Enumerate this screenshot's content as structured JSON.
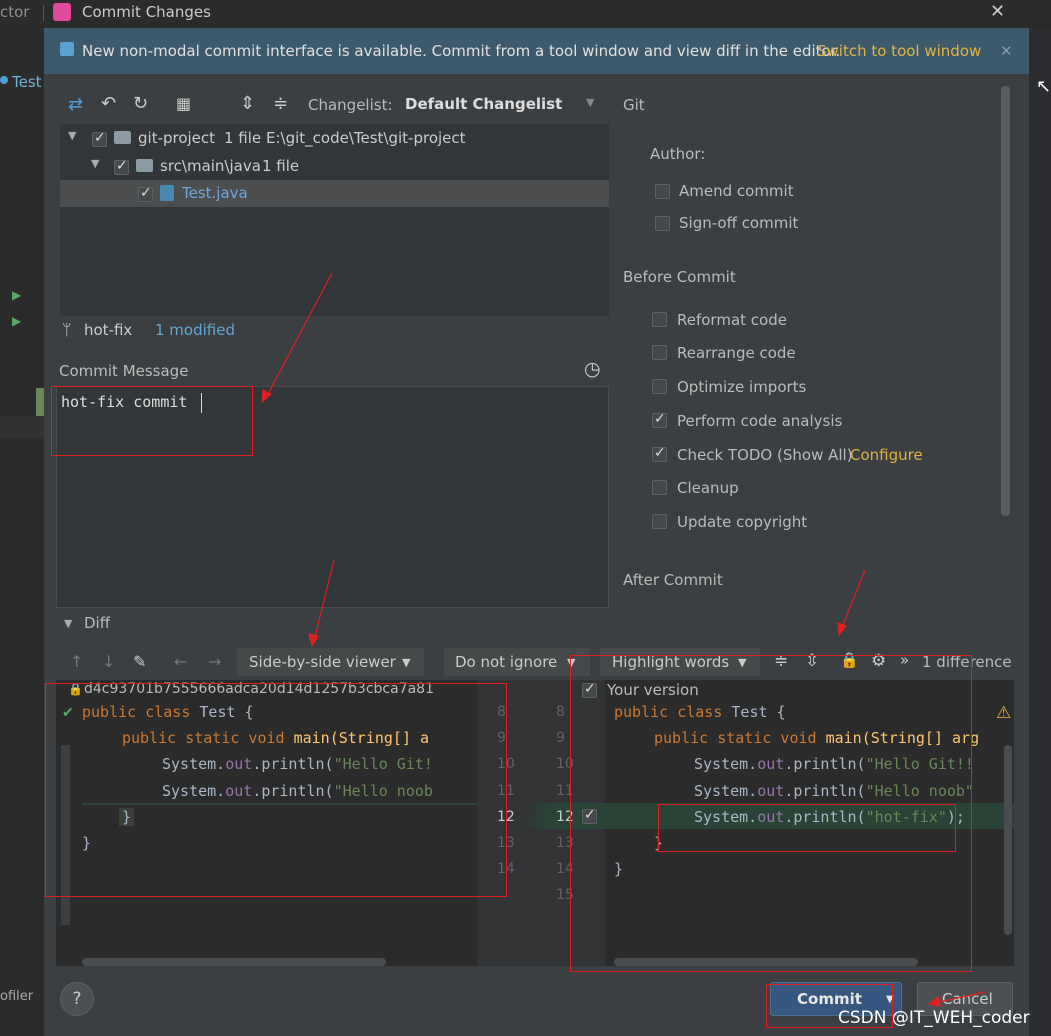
{
  "titlebar": {
    "left_fragment": "ctor",
    "title": "Commit Changes",
    "close_glyph": "✕"
  },
  "ide": {
    "tab_label": "Test",
    "profiler_fragment": "ofiler"
  },
  "banner": {
    "text": "New non-modal commit interface is available. Commit from a tool window and view diff in the editor.",
    "link": "Switch to tool window",
    "close_glyph": "✕"
  },
  "toolbar": {
    "changelist_label": "Changelist:",
    "changelist_value": "Default Changelist"
  },
  "tree": {
    "root": {
      "name": "git-project",
      "count": "1 file",
      "path": "E:\\git_code\\Test\\git-project"
    },
    "folder": {
      "name": "src\\main\\java",
      "count": "1 file"
    },
    "file": {
      "name": "Test.java"
    }
  },
  "status": {
    "branch": "hot-fix",
    "modified": "1 modified"
  },
  "commit_message": {
    "label": "Commit Message",
    "value": "hot-fix commit"
  },
  "git_panel": {
    "header": "Git",
    "author_label": "Author:",
    "amend": "Amend commit",
    "signoff": "Sign-off commit",
    "before_commit": "Before Commit",
    "options": [
      {
        "label": "Reformat code",
        "checked": false
      },
      {
        "label": "Rearrange code",
        "checked": false
      },
      {
        "label": "Optimize imports",
        "checked": false
      },
      {
        "label": "Perform code analysis",
        "checked": true
      },
      {
        "label": "Check TODO (Show All)",
        "checked": true,
        "link": "Configure"
      },
      {
        "label": "Cleanup",
        "checked": false
      },
      {
        "label": "Update copyright",
        "checked": false
      }
    ],
    "after_commit": "After Commit"
  },
  "diff": {
    "label": "Diff",
    "viewer": "Side-by-side viewer",
    "ignore": "Do not ignore",
    "highlight": "Highlight words",
    "more": "»",
    "count": "1 difference",
    "left_header": "d4c93701b7555666adca20d14d1257b3cbca7a81",
    "right_header": "Your version",
    "left": {
      "l1_kw": "public class",
      "l1_name": "Test {",
      "l2_kw": "public static void",
      "l2_rest": "main(String[] a",
      "l3_a": "System.",
      "l3_b": "out",
      "l3_c": ".println(",
      "l3_d": "\"Hello Git!",
      "l4_a": "System.",
      "l4_b": "out",
      "l4_c": ".println(",
      "l4_d": "\"Hello noob",
      "l5": "}",
      "l6": "}"
    },
    "right": {
      "l1_kw": "public class",
      "l1_name": "Test {",
      "l2_kw": "public static void",
      "l2_rest": "main(String[] arg",
      "l3_a": "System.",
      "l3_b": "out",
      "l3_c": ".println(",
      "l3_d": "\"Hello Git!!",
      "l4_a": "System.",
      "l4_b": "out",
      "l4_c": ".println(",
      "l4_d": "\"Hello noob\"",
      "l5_a": "System.",
      "l5_b": "out",
      "l5_c": ".println(",
      "l5_d": "\"hot-fix\"",
      "l5_e": ");",
      "l6": "}",
      "l7": "}"
    },
    "left_numbers": [
      "8",
      "9",
      "10",
      "11",
      "12",
      "13",
      "14"
    ],
    "right_numbers": [
      "8",
      "9",
      "10",
      "11",
      "12",
      "13",
      "14",
      "15"
    ]
  },
  "footer": {
    "help": "?",
    "commit": "Commit",
    "cancel": "Cancel"
  },
  "watermark": "CSDN @IT_WEH_coder",
  "colors": {
    "accent_link": "#e3b341",
    "banner_bg": "#3d5a6c",
    "added_line": "#294436",
    "annotation_red": "#e02020"
  }
}
